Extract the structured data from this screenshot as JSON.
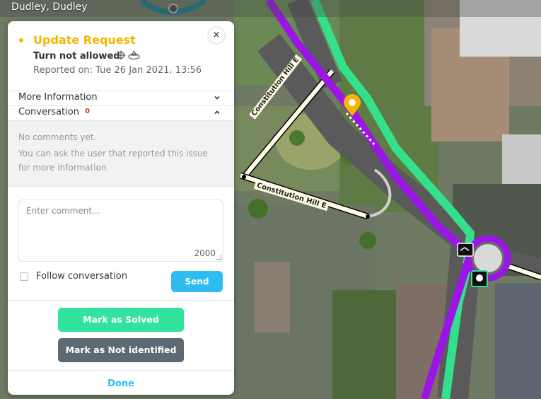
{
  "map": {
    "location": "Dudley, Dudley",
    "street_labels": [
      "Constitution Hill E",
      "Constitution Hill E"
    ]
  },
  "panel": {
    "title": "Update Request",
    "subtitle": "Turn not allowed",
    "reported": "Reported on: Tue 26 Jan 2021, 13:56",
    "close_icon": "×",
    "more_info_label": "More Information",
    "conversation_label": "Conversation",
    "conversation_count": "0",
    "no_comments": "No comments yet.",
    "hint": "You can ask the user that reported this issue for more information",
    "comment_placeholder": "Enter comment...",
    "comment_counter": "2000",
    "follow_label": "Follow conversation",
    "send_label": "Send",
    "solved_label": "Mark as Solved",
    "not_identified_label": "Mark as Not identified",
    "done_label": "Done"
  },
  "colors": {
    "accent": "#f7b500",
    "send": "#2ebdee",
    "solved": "#32e3a0",
    "not_identified": "#5d6a72",
    "route_purple": "#9b16e6",
    "route_green": "#35e08d",
    "badge_red": "#e0302a"
  },
  "icons": {
    "close": "close-icon",
    "chevron_more": "chevron-down-icon",
    "chevron_convo": "chevron-up-icon",
    "crosshair": "crosshair-icon",
    "layers": "layers-icon",
    "marker": "update-request-marker-icon"
  }
}
